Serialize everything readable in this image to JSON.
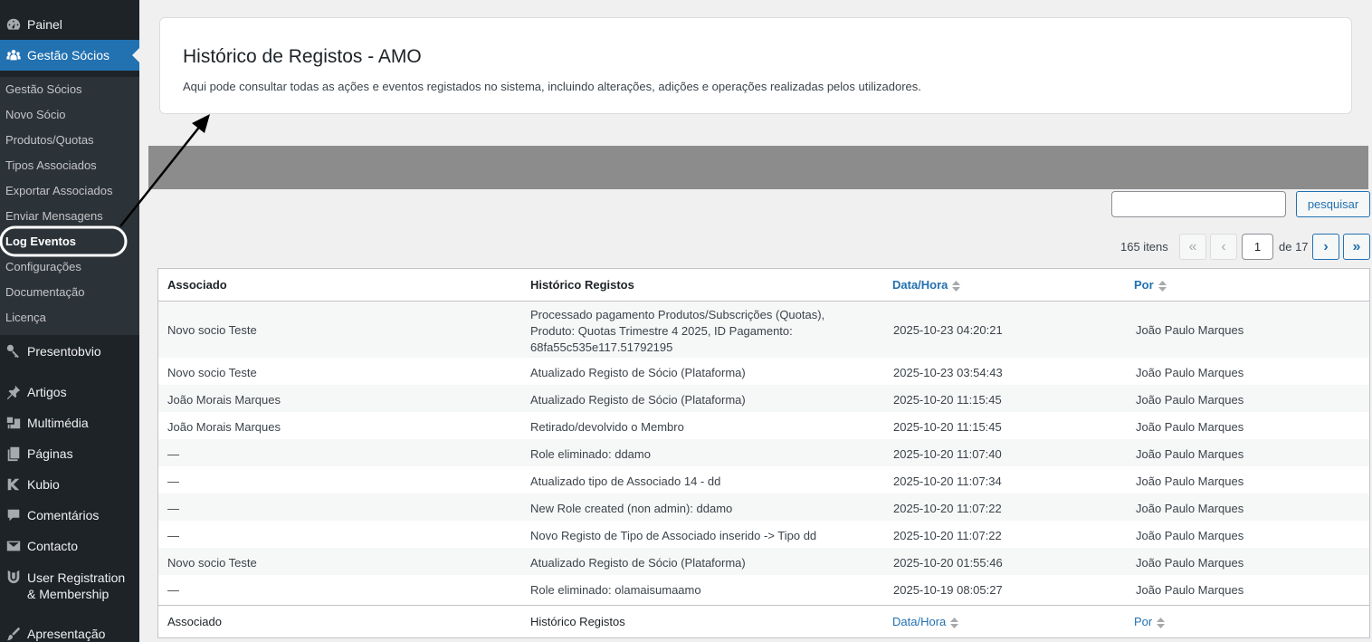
{
  "sidebar": {
    "items": [
      {
        "label": "Painel",
        "icon": "dashboard-icon"
      },
      {
        "label": "Gestão Sócios",
        "icon": "groups-icon"
      },
      {
        "label": "Presentobvio",
        "icon": "key-icon"
      },
      {
        "label": "Artigos",
        "icon": "pushpin-icon"
      },
      {
        "label": "Multimédia",
        "icon": "media-icon"
      },
      {
        "label": "Páginas",
        "icon": "pages-icon"
      },
      {
        "label": "Kubio",
        "icon": "kubio-icon"
      },
      {
        "label": "Comentários",
        "icon": "comments-icon"
      },
      {
        "label": "Contacto",
        "icon": "mail-icon"
      },
      {
        "label": "User Registration",
        "label2": "& Membership",
        "icon": "user-registration-icon"
      },
      {
        "label": "Apresentação",
        "icon": "brush-icon"
      }
    ],
    "submenu": [
      "Gestão Sócios",
      "Novo Sócio",
      "Produtos/Quotas",
      "Tipos Associados",
      "Exportar Associados",
      "Enviar Mensagens",
      "Log Eventos",
      "Configurações",
      "Documentação",
      "Licença"
    ],
    "accent_color": "#2271b1",
    "background_color": "#1d2327"
  },
  "header": {
    "title": "Histórico de Registos - AMO",
    "description": "Aqui pode consultar todas as ações e eventos registados no sistema, incluindo alterações, adições e operações realizadas pelos utilizadores."
  },
  "search": {
    "value": "",
    "button_label": "pesquisar"
  },
  "pagination": {
    "items_count": "165 itens",
    "first": "«",
    "prev": "‹",
    "current_page": "1",
    "of_label": "de 17",
    "next": "›",
    "last": "»"
  },
  "table": {
    "columns": [
      "Associado",
      "Histórico Registos",
      "Data/Hora",
      "Por"
    ],
    "rows": [
      {
        "associado": "Novo socio Teste",
        "historico": [
          "Processado pagamento Produtos/Subscrições (Quotas),",
          "Produto: Quotas Trimestre 4 2025, ID Pagamento:",
          "68fa55c535e117.51792195"
        ],
        "data": "2025-10-23 04:20:21",
        "por": "João Paulo Marques"
      },
      {
        "associado": "Novo socio Teste",
        "historico": [
          "Atualizado Registo de Sócio (Plataforma)"
        ],
        "data": "2025-10-23 03:54:43",
        "por": "João Paulo Marques"
      },
      {
        "associado": "João Morais Marques",
        "historico": [
          "Atualizado Registo de Sócio (Plataforma)"
        ],
        "data": "2025-10-20 11:15:45",
        "por": "João Paulo Marques"
      },
      {
        "associado": "João Morais Marques",
        "historico": [
          "Retirado/devolvido o Membro"
        ],
        "data": "2025-10-20 11:15:45",
        "por": "João Paulo Marques"
      },
      {
        "associado": "—",
        "historico": [
          "Role eliminado: ddamo"
        ],
        "data": "2025-10-20 11:07:40",
        "por": "João Paulo Marques"
      },
      {
        "associado": "—",
        "historico": [
          "Atualizado tipo de Associado 14 - dd"
        ],
        "data": "2025-10-20 11:07:34",
        "por": "João Paulo Marques"
      },
      {
        "associado": "—",
        "historico": [
          "New Role created (non admin): ddamo"
        ],
        "data": "2025-10-20 11:07:22",
        "por": "João Paulo Marques"
      },
      {
        "associado": "—",
        "historico": [
          "Novo Registo de Tipo de Associado inserido -> Tipo dd"
        ],
        "data": "2025-10-20 11:07:22",
        "por": "João Paulo Marques"
      },
      {
        "associado": "Novo socio Teste",
        "historico": [
          "Atualizado Registo de Sócio (Plataforma)"
        ],
        "data": "2025-10-20 01:55:46",
        "por": "João Paulo Marques"
      },
      {
        "associado": "—",
        "historico": [
          "Role eliminado: olamaisumaamo"
        ],
        "data": "2025-10-19 08:05:27",
        "por": "João Paulo Marques"
      }
    ]
  }
}
